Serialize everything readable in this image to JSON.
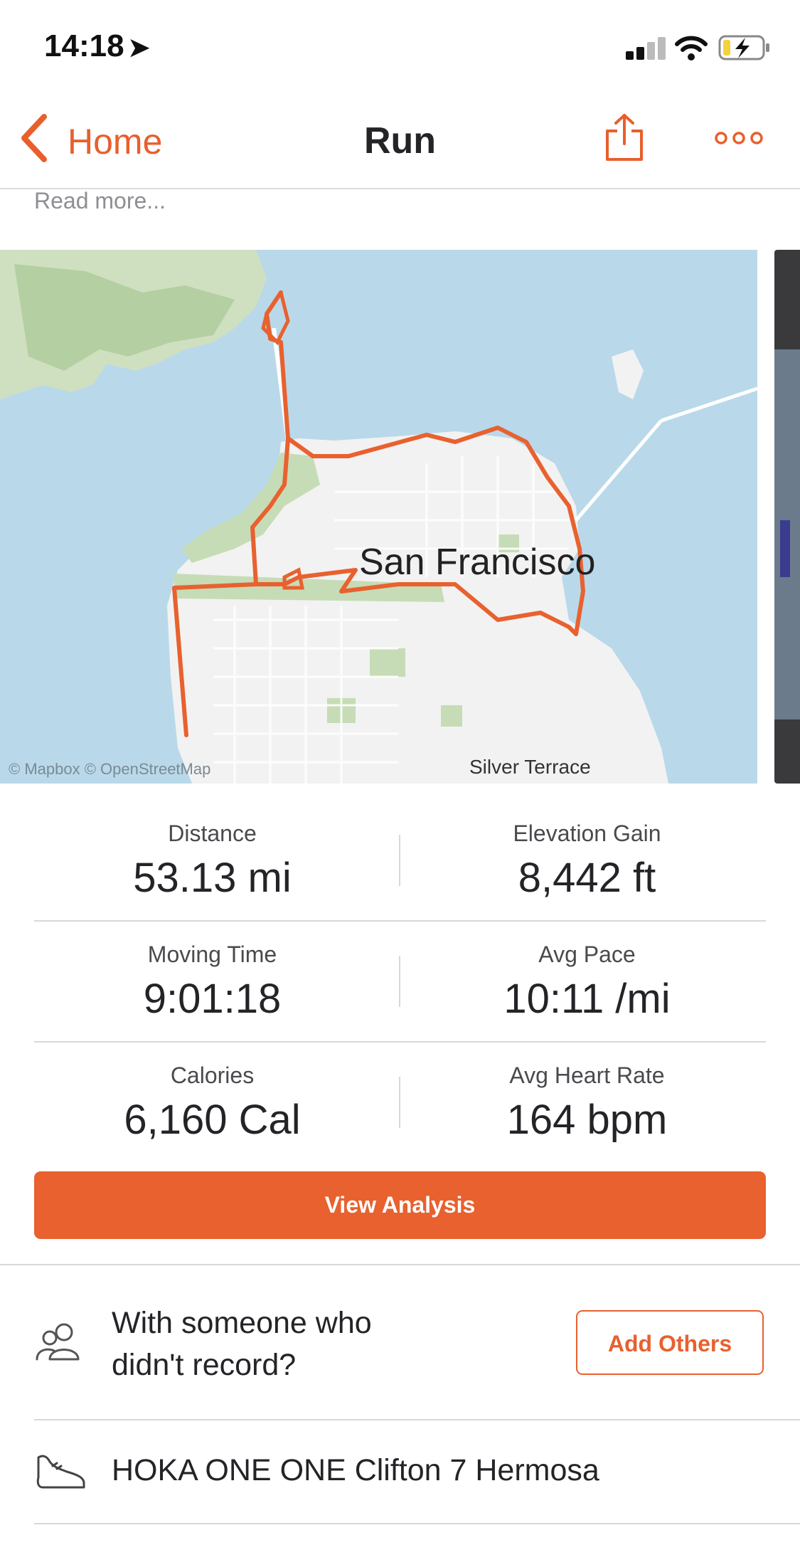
{
  "status_bar": {
    "time": "14:18",
    "location_icon": "location-arrow-icon",
    "signal_icon": "cellular-signal-icon",
    "wifi_icon": "wifi-icon",
    "battery_icon": "battery-charging-icon"
  },
  "nav": {
    "back_label": "Home",
    "title": "Run",
    "share_icon": "share-icon",
    "more_icon": "more-icon"
  },
  "description": {
    "read_more": "Read more..."
  },
  "map": {
    "city_label": "San Francisco",
    "neighborhood_label": "Silver Terrace",
    "attribution": "© Mapbox © OpenStreetMap",
    "route_color": "#e8612f",
    "water_color": "#b9d9ea",
    "land_color": "#f2f2f2",
    "park_color": "#c6dcb6"
  },
  "stats": [
    {
      "label": "Distance",
      "value": "53.13 mi"
    },
    {
      "label": "Elevation Gain",
      "value": "8,442 ft"
    },
    {
      "label": "Moving Time",
      "value": "9:01:18"
    },
    {
      "label": "Avg Pace",
      "value": "10:11 /mi"
    },
    {
      "label": "Calories",
      "value": "6,160 Cal"
    },
    {
      "label": "Avg Heart Rate",
      "value": "164 bpm"
    }
  ],
  "actions": {
    "view_analysis": "View Analysis",
    "with_someone": "With someone who didn't record?",
    "add_others": "Add Others",
    "people_icon": "people-icon"
  },
  "gear": {
    "name": "HOKA ONE ONE Clifton 7 Hermosa",
    "icon": "shoe-icon"
  },
  "colors": {
    "accent": "#e8612f",
    "text": "#242428",
    "muted": "#8e8e93"
  }
}
